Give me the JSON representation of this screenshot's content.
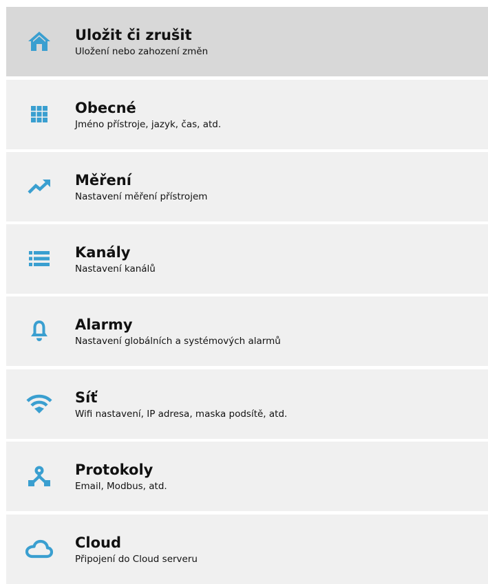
{
  "theme": {
    "icon_color": "#3a9fd0",
    "item_background": "#f0f0f0",
    "active_background": "#d8d8d8",
    "text_color": "#111111"
  },
  "menu": {
    "items": [
      {
        "title": "Uložit či zrušit",
        "subtitle": "Uložení nebo zahození změn",
        "icon": "home-icon",
        "active": true
      },
      {
        "title": "Obecné",
        "subtitle": "Jméno přístroje, jazyk, čas, atd.",
        "icon": "grid-icon",
        "active": false
      },
      {
        "title": "Měření",
        "subtitle": "Nastavení měření přístrojem",
        "icon": "trending-up-icon",
        "active": false
      },
      {
        "title": "Kanály",
        "subtitle": "Nastavení kanálů",
        "icon": "list-icon",
        "active": false
      },
      {
        "title": "Alarmy",
        "subtitle": "Nastavení globálních a systémových alarmů",
        "icon": "bell-icon",
        "active": false
      },
      {
        "title": "Síť",
        "subtitle": "Wifi nastavení, IP adresa, maska podsítě, atd.",
        "icon": "wifi-icon",
        "active": false
      },
      {
        "title": "Protokoly",
        "subtitle": "Email, Modbus, atd.",
        "icon": "network-icon",
        "active": false
      },
      {
        "title": "Cloud",
        "subtitle": "Připojení do Cloud serveru",
        "icon": "cloud-icon",
        "active": false
      }
    ]
  }
}
